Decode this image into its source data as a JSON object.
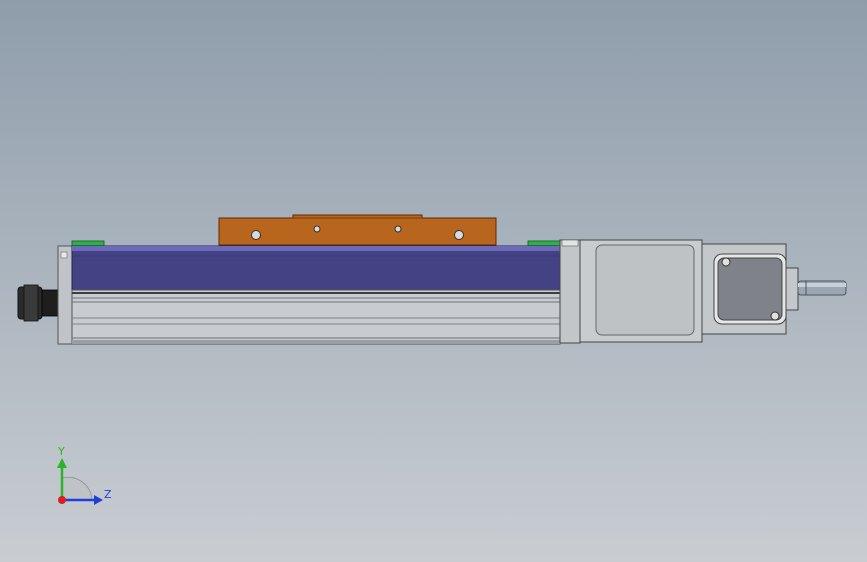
{
  "viewport": {
    "background_top": "#8f9dab",
    "background_bottom": "#c9cdd2"
  },
  "colors": {
    "carriage": "#b8651e",
    "carriage_dark": "#7a3c0c",
    "rail_cover": "#434284",
    "rail_cover_light": "#6b6ab8",
    "extrusion": "#c8ccd0",
    "extrusion_dark": "#6e7276",
    "end_block": "#2fae4a",
    "motor_body": "#c9cccf",
    "motor_plate": "#7f8389",
    "connector": "#2b2b2b",
    "shaft": "#9aa6b2",
    "axis_y": "#2bb32b",
    "axis_z": "#1f3fd8",
    "axis_x": "#d82020"
  },
  "triad": {
    "y_label": "Y",
    "z_label": "Z"
  }
}
